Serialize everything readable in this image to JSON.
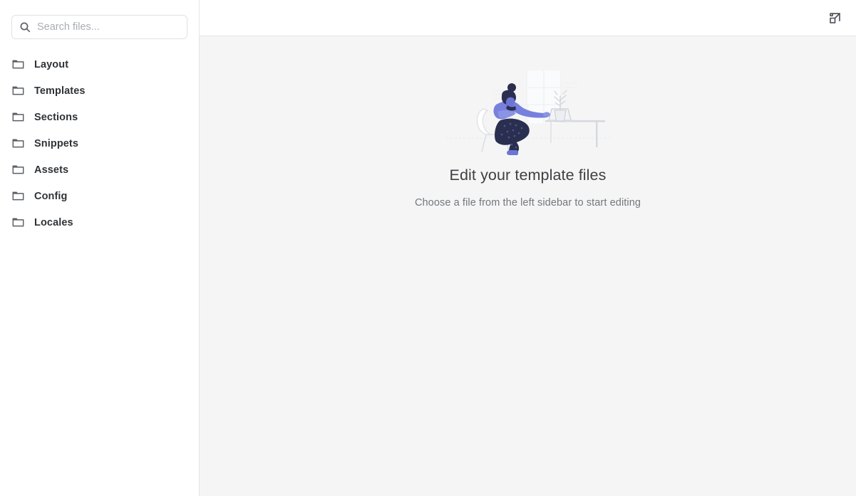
{
  "sidebar": {
    "search": {
      "placeholder": "Search files...",
      "value": "",
      "icon": "search-icon"
    },
    "items": [
      {
        "label": "Layout",
        "icon": "folder-icon"
      },
      {
        "label": "Templates",
        "icon": "folder-icon"
      },
      {
        "label": "Sections",
        "icon": "folder-icon"
      },
      {
        "label": "Snippets",
        "icon": "folder-icon"
      },
      {
        "label": "Assets",
        "icon": "folder-icon"
      },
      {
        "label": "Config",
        "icon": "folder-icon"
      },
      {
        "label": "Locales",
        "icon": "folder-icon"
      }
    ]
  },
  "topbar": {
    "expand_icon": "expand-external-icon"
  },
  "empty_state": {
    "illustration": "person-at-desk-illustration",
    "title": "Edit your template files",
    "subtitle": "Choose a file from the left sidebar to start editing"
  },
  "colors": {
    "accent": "#6c74d6",
    "accent_dark": "#2b2f4f",
    "sidebar_bg": "#ffffff",
    "content_bg": "#f5f5f5",
    "border": "#e3e5e8",
    "text_primary": "#2f3337",
    "text_secondary": "#73777d"
  }
}
